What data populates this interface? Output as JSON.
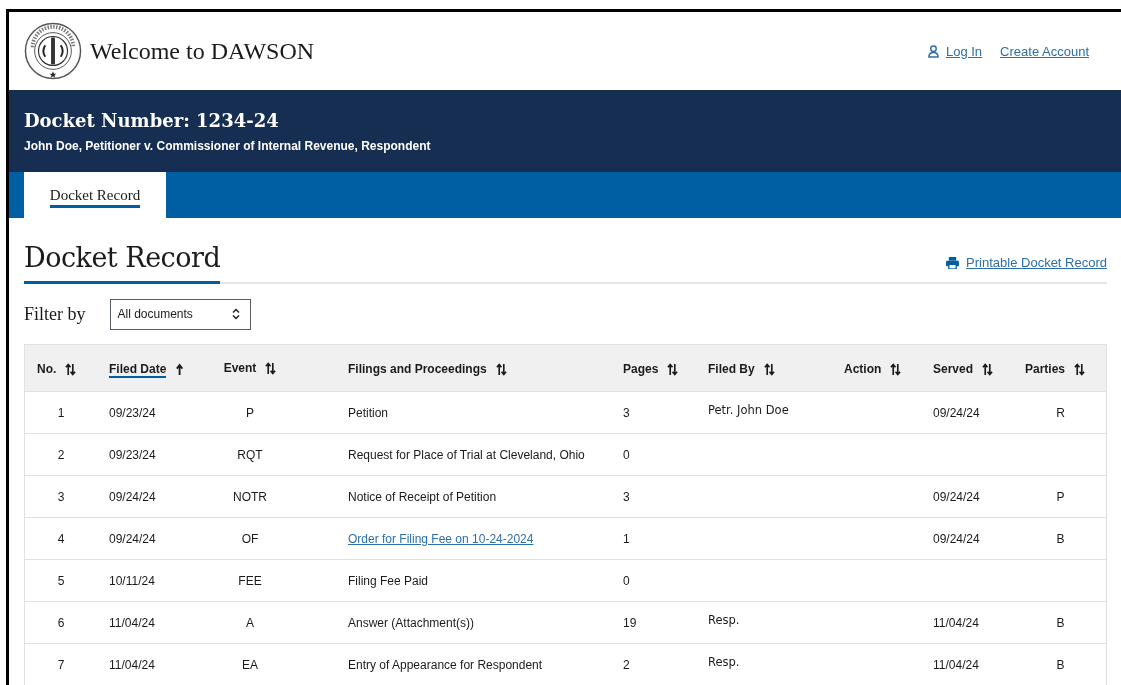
{
  "header": {
    "title": "Welcome to DAWSON",
    "links": [
      {
        "label": "Log In",
        "icon": true
      },
      {
        "label": "Create Account",
        "icon": false
      }
    ]
  },
  "case": {
    "docket_number": "Docket Number: 1234-24",
    "caption": "John Doe, Petitioner v. Commissioner of Internal Revenue, Respondent"
  },
  "tabs": [
    {
      "label": "Docket Record",
      "selected": true
    }
  ],
  "section": {
    "title": "Docket Record",
    "print_link": "Printable Docket Record"
  },
  "filter": {
    "label": "Filter by",
    "value": "All documents"
  },
  "table": {
    "columns": [
      {
        "label": "No.",
        "sorted": false
      },
      {
        "label": "Filed Date",
        "sorted": true
      },
      {
        "label": "Event",
        "sorted": false
      },
      {
        "label": "Filings and Proceedings",
        "sorted": false
      },
      {
        "label": "Pages",
        "sorted": false
      },
      {
        "label": "Filed By",
        "sorted": false
      },
      {
        "label": "Action",
        "sorted": false
      },
      {
        "label": "Served",
        "sorted": false
      },
      {
        "label": "Parties",
        "sorted": false
      }
    ],
    "rows": [
      {
        "cells": [
          "1",
          "09/23/24",
          "P",
          "Petition",
          "3",
          "Petr. John Doe",
          "",
          "09/24/24",
          "R"
        ],
        "link": false
      },
      {
        "cells": [
          "2",
          "09/23/24",
          "RQT",
          "Request for Place of Trial at Cleveland, Ohio",
          "0",
          "",
          "",
          "",
          ""
        ],
        "link": false
      },
      {
        "cells": [
          "3",
          "09/24/24",
          "NOTR",
          "Notice of Receipt of Petition",
          "3",
          "",
          "",
          "09/24/24",
          "P"
        ],
        "link": false
      },
      {
        "cells": [
          "4",
          "09/24/24",
          "OF",
          "Order for Filing Fee on 10-24-2024",
          "1",
          "",
          "",
          "09/24/24",
          "B"
        ],
        "link": true
      },
      {
        "cells": [
          "5",
          "10/11/24",
          "FEE",
          "Filing Fee Paid",
          "0",
          "",
          "",
          "",
          ""
        ],
        "link": false
      },
      {
        "cells": [
          "6",
          "11/04/24",
          "A",
          "Answer (Attachment(s))",
          "19",
          "Resp.",
          "",
          "11/04/24",
          "B"
        ],
        "link": false
      },
      {
        "cells": [
          "7",
          "11/04/24",
          "EA",
          "Entry of Appearance for Respondent",
          "2",
          "Resp.",
          "",
          "11/04/24",
          "B"
        ],
        "link": false
      }
    ]
  }
}
